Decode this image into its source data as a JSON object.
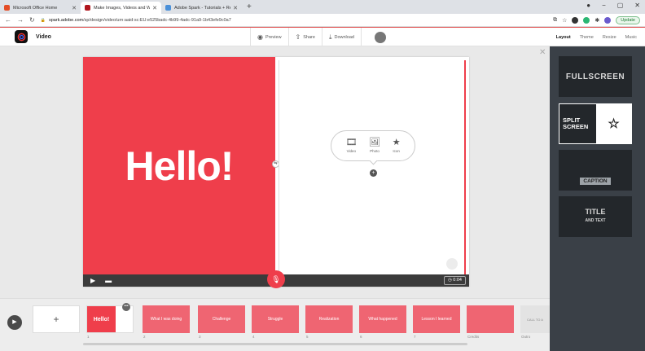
{
  "browser": {
    "tabs": [
      {
        "title": "Microsoft Office Home",
        "color": "#e44d26",
        "active": false
      },
      {
        "title": "Make Images, Videos and Web S",
        "color": "#b0161d",
        "active": true
      },
      {
        "title": "Adobe Spark - Tutorials + Resou",
        "color": "#4a90d9",
        "active": false
      }
    ],
    "new_tab": "+",
    "win_min": "−",
    "win_max": "▢",
    "win_close": "✕",
    "url_host": "spark.adobe.com",
    "url_path": "/sp/design/video/urn:aaid:sc:EU:e525badc-4b99-4adc-91a9-1b43efe9c0a7",
    "update_label": "Update"
  },
  "app": {
    "title": "Video",
    "actions": {
      "preview": "Preview",
      "share": "Share",
      "download": "Download"
    },
    "right_tabs": [
      "Layout",
      "Theme",
      "Resize",
      "Music"
    ],
    "active_tab": "Layout"
  },
  "stage": {
    "hello_text": "Hello!",
    "popover": {
      "video": "Video",
      "photo": "Photo",
      "icon": "Icon"
    },
    "add": "+",
    "time": "0:04"
  },
  "layouts": {
    "fullscreen": "FULLSCREEN",
    "split_line1": "SPLIT",
    "split_line2": "SCREEN",
    "caption": "CAPTION",
    "title_line1": "TITLE",
    "title_line2": "AND TEXT"
  },
  "timeline": {
    "add": "+",
    "first_slide": "Hello!",
    "slides": [
      {
        "label": "What I was doing",
        "num": "2"
      },
      {
        "label": "Challenge",
        "num": "3"
      },
      {
        "label": "Struggle",
        "num": "4"
      },
      {
        "label": "Realization",
        "num": "5"
      },
      {
        "label": "What happened",
        "num": "6"
      },
      {
        "label": "Lesson I learned",
        "num": "7"
      },
      {
        "label": "",
        "num": "Credits"
      }
    ],
    "first_num": "1",
    "cta": "CALL TO A",
    "cta_num": "Outro"
  }
}
